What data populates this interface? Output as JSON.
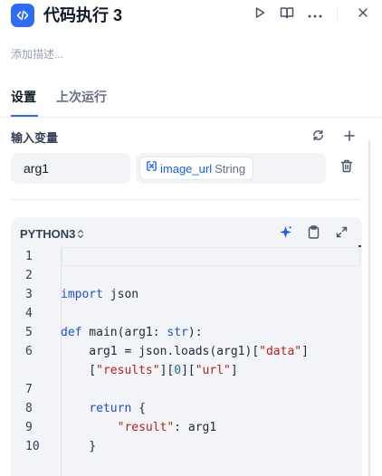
{
  "header": {
    "title": "代码执行 3",
    "node_icon": "code-icon",
    "actions": [
      "play-icon",
      "book-icon",
      "more-icon",
      "close-icon"
    ]
  },
  "description_placeholder": "添加描述...",
  "tabs": [
    {
      "label": "设置",
      "active": true
    },
    {
      "label": "上次运行",
      "active": false
    }
  ],
  "input_variables": {
    "label": "输入变量",
    "items": [
      {
        "name": "arg1",
        "value_var": "image_url",
        "value_type": "String"
      }
    ]
  },
  "editor": {
    "language": "PYTHON3",
    "line_numbers": [
      "1",
      "2",
      "3",
      "4",
      "5",
      "6",
      "",
      "7",
      "8",
      "9",
      "10"
    ],
    "lines": [
      [],
      [],
      [
        {
          "t": "import",
          "c": "kw"
        },
        {
          "t": " json"
        }
      ],
      [],
      [
        {
          "t": "def",
          "c": "kw"
        },
        {
          "t": " main(arg1: "
        },
        {
          "t": "str",
          "c": "kw"
        },
        {
          "t": "):"
        }
      ],
      [
        {
          "t": "    arg1 = json.loads(arg1)["
        },
        {
          "t": "\"data\"",
          "c": "str"
        },
        {
          "t": "]"
        }
      ],
      [
        {
          "t": "    ["
        },
        {
          "t": "\"results\"",
          "c": "str"
        },
        {
          "t": "]["
        },
        {
          "t": "0",
          "c": "num"
        },
        {
          "t": "]["
        },
        {
          "t": "\"url\"",
          "c": "str"
        },
        {
          "t": "]"
        }
      ],
      [],
      [
        {
          "t": "    "
        },
        {
          "t": "return",
          "c": "kw"
        },
        {
          "t": " {"
        }
      ],
      [
        {
          "t": "        "
        },
        {
          "t": "\"result\"",
          "c": "str"
        },
        {
          "t": ": arg1"
        }
      ],
      [
        {
          "t": "    }"
        }
      ]
    ]
  },
  "colors": {
    "accent": "#2e6cf6",
    "editor_bg": "#f2f4f7",
    "keyword": "#1d4ed8",
    "string": "#b42318"
  }
}
